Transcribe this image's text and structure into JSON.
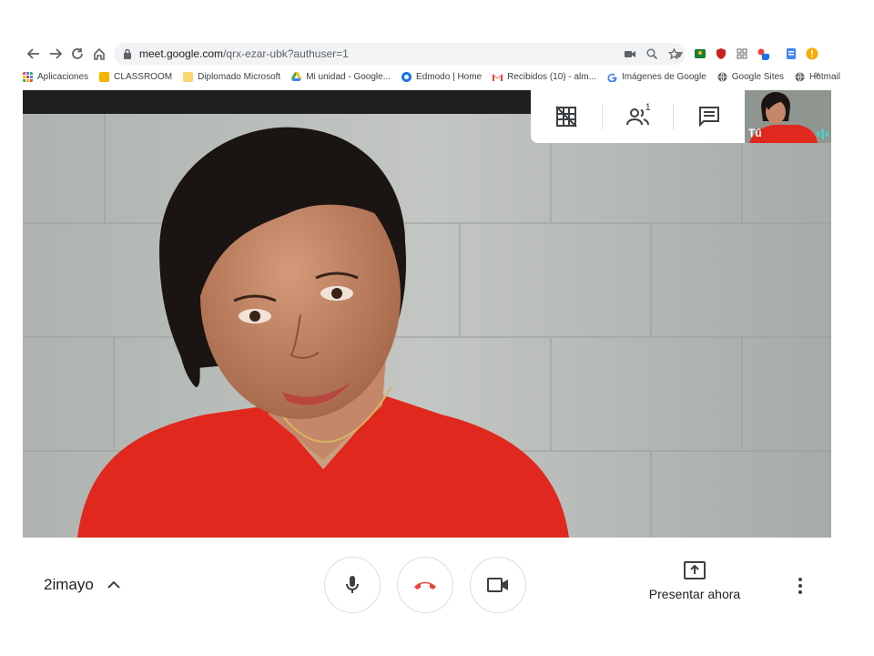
{
  "browser": {
    "url_host": "meet.google.com",
    "url_path": "/qrx-ezar-ubk?authuser=1",
    "bookmarks": [
      {
        "label": "Aplicaciones",
        "icon": "apps-grid-icon",
        "color": "#ea4335"
      },
      {
        "label": "CLASSROOM",
        "icon": "classroom-icon",
        "color": "#f4b400"
      },
      {
        "label": "Diplomado Microsoft",
        "icon": "folder-icon",
        "color": "#fbd66e"
      },
      {
        "label": "Mi unidad - Google...",
        "icon": "drive-icon",
        "color": "#34a853"
      },
      {
        "label": "Edmodo | Home",
        "icon": "edmodo-icon",
        "color": "#1a73e8"
      },
      {
        "label": "Recibidos (10) - alm...",
        "icon": "gmail-icon",
        "color": "#ea4335"
      },
      {
        "label": "Imágenes de Google",
        "icon": "google-icon",
        "color": "#4285f4"
      },
      {
        "label": "Google Sites",
        "icon": "globe-icon",
        "color": "#5f6368"
      },
      {
        "label": "Hotmail",
        "icon": "globe-icon",
        "color": "#5f6368"
      }
    ],
    "bookmarks_more": "»"
  },
  "meet": {
    "participants_count": "1",
    "self_label": "Tú",
    "meeting_name": "2imayo",
    "present_label": "Presentar ahora"
  },
  "colors": {
    "accent_red": "#ea4335",
    "text_dark": "#202124",
    "icon_gray": "#5f6368",
    "audio_teal": "#4ecdc4"
  }
}
